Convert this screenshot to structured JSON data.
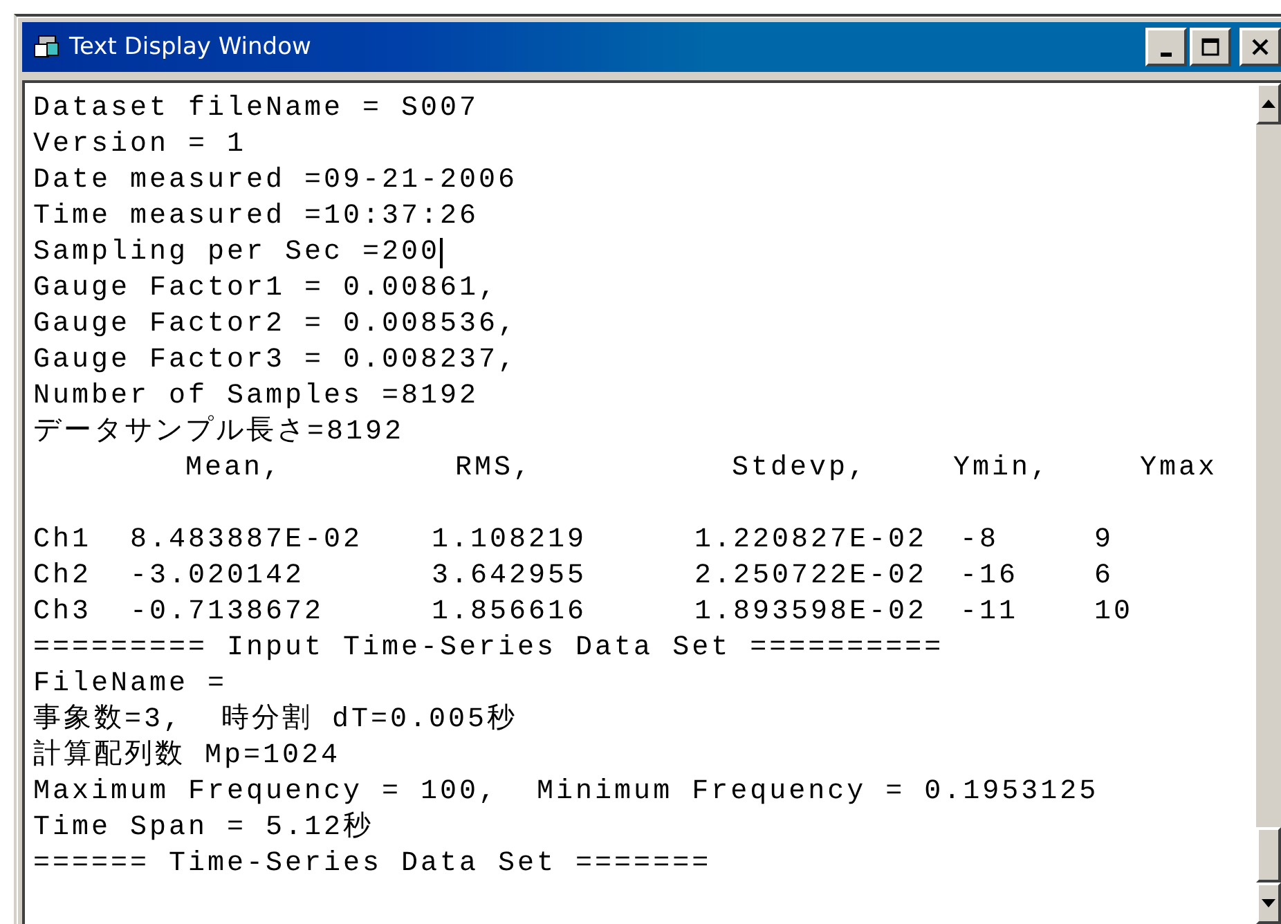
{
  "window": {
    "title": "Text Display Window"
  },
  "header_lines": [
    {
      "text": "Dataset fileName = S007",
      "caret": false
    },
    {
      "text": "Version = 1",
      "caret": false
    },
    {
      "text": "Date measured =09-21-2006",
      "caret": false
    },
    {
      "text": "Time measured =10:37:26",
      "caret": false
    },
    {
      "text": "Sampling per Sec =200",
      "caret": true
    },
    {
      "text": "Gauge Factor1 = 0.00861,",
      "caret": false
    },
    {
      "text": "Gauge Factor2 = 0.008536,",
      "caret": false
    },
    {
      "text": "Gauge Factor3 = 0.008237,",
      "caret": false
    },
    {
      "text": "Number of Samples =8192",
      "caret": false
    },
    {
      "text": "データサンプル長さ=8192",
      "caret": false
    }
  ],
  "stats": {
    "columns": [
      "Mean,",
      "RMS,",
      "Stdevp,",
      "Ymin,",
      "Ymax"
    ],
    "rows": [
      {
        "label": "Ch1",
        "cells": [
          "8.483887E-02",
          "1.108219",
          "1.220827E-02",
          "-8",
          "9"
        ]
      },
      {
        "label": "Ch2",
        "cells": [
          "-3.020142",
          "3.642955",
          "2.250722E-02",
          "-16",
          "6"
        ]
      },
      {
        "label": "Ch3",
        "cells": [
          "-0.7138672",
          "1.856616",
          "1.893598E-02",
          "-11",
          "10"
        ]
      }
    ]
  },
  "footer_lines": [
    "========= Input Time-Series Data Set ==========",
    "FileName =",
    "事象数=3,  時分割 dT=0.005秒",
    "計算配列数 Mp=1024",
    "Maximum Frequency = 100,  Minimum Frequency = 0.1953125",
    "Time Span = 5.12秒",
    "====== Time-Series Data Set ======="
  ]
}
